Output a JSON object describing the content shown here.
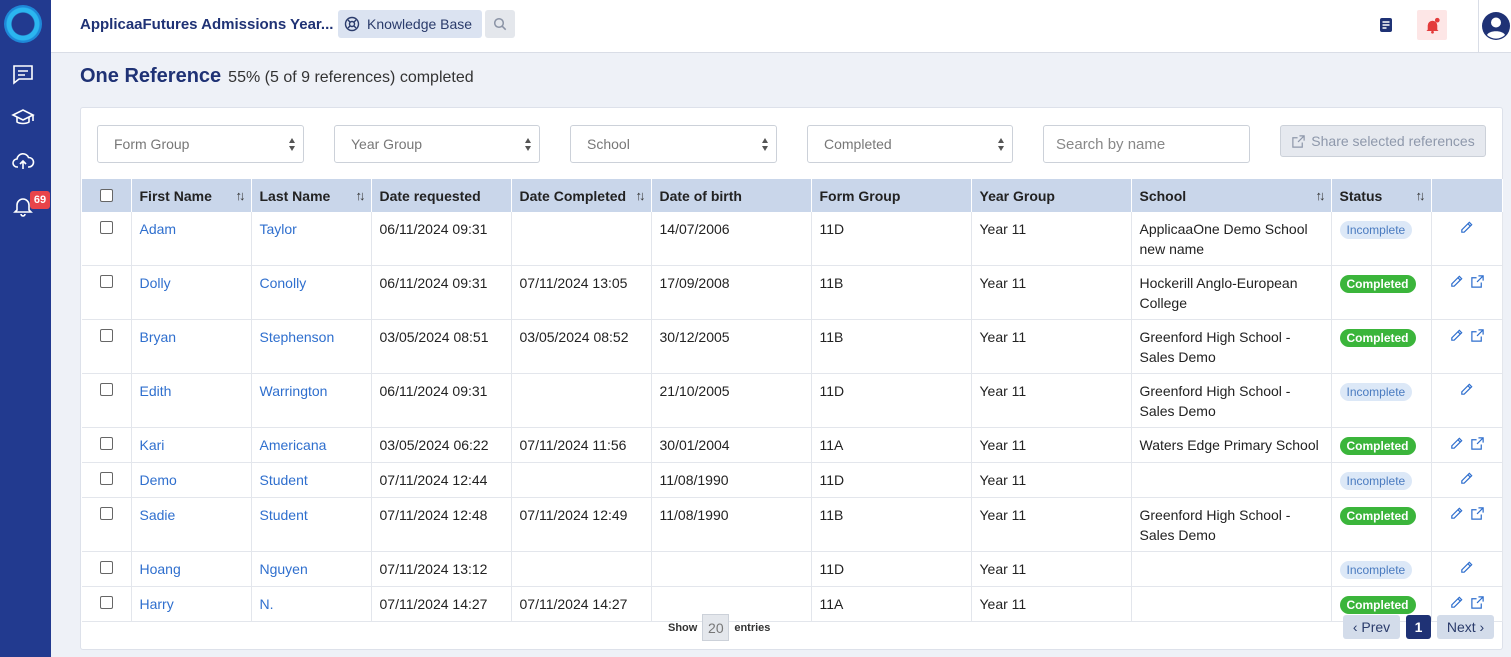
{
  "topbar": {
    "app_title": "ApplicaaFutures Admissions Year...",
    "kb_label": "Knowledge Base"
  },
  "sidebar": {
    "notification_count": "69",
    "icons": [
      "messages-icon",
      "graduation-cap-icon",
      "cloud-upload-icon",
      "bell-icon"
    ]
  },
  "header": {
    "title": "One Reference",
    "progress": "55% (5 of 9 references) completed"
  },
  "filters": {
    "form_group": "Form Group",
    "year_group": "Year Group",
    "school": "School",
    "completed": "Completed",
    "search_placeholder": "Search by name",
    "share_label": "Share selected references"
  },
  "table": {
    "columns": [
      "First Name",
      "Last Name",
      "Date requested",
      "Date Completed",
      "Date of birth",
      "Form Group",
      "Year Group",
      "School",
      "Status"
    ],
    "rows": [
      {
        "first": "Adam",
        "last": "Taylor",
        "requested": "06/11/2024 09:31",
        "completed": "",
        "dob": "14/07/2006",
        "form": "11D",
        "year": "Year 11",
        "school": "ApplicaaOne Demo School new name",
        "status": "Incomplete"
      },
      {
        "first": "Dolly",
        "last": "Conolly",
        "requested": "06/11/2024 09:31",
        "completed": "07/11/2024 13:05",
        "dob": "17/09/2008",
        "form": "11B",
        "year": "Year 11",
        "school": "Hockerill Anglo-European College",
        "status": "Completed"
      },
      {
        "first": "Bryan",
        "last": "Stephenson",
        "requested": "03/05/2024 08:51",
        "completed": "03/05/2024 08:52",
        "dob": "30/12/2005",
        "form": "11B",
        "year": "Year 11",
        "school": "Greenford High School - Sales Demo",
        "status": "Completed"
      },
      {
        "first": "Edith",
        "last": "Warrington",
        "requested": "06/11/2024 09:31",
        "completed": "",
        "dob": "21/10/2005",
        "form": "11D",
        "year": "Year 11",
        "school": "Greenford High School - Sales Demo",
        "status": "Incomplete"
      },
      {
        "first": "Kari",
        "last": "Americana",
        "requested": "03/05/2024 06:22",
        "completed": "07/11/2024 11:56",
        "dob": "30/01/2004",
        "form": "11A",
        "year": "Year 11",
        "school": "Waters Edge Primary School",
        "status": "Completed"
      },
      {
        "first": "Demo",
        "last": "Student",
        "requested": "07/11/2024 12:44",
        "completed": "",
        "dob": "11/08/1990",
        "form": "11D",
        "year": "Year 11",
        "school": "",
        "status": "Incomplete"
      },
      {
        "first": "Sadie",
        "last": "Student",
        "requested": "07/11/2024 12:48",
        "completed": "07/11/2024 12:49",
        "dob": "11/08/1990",
        "form": "11B",
        "year": "Year 11",
        "school": "Greenford High School - Sales Demo",
        "status": "Completed"
      },
      {
        "first": "Hoang",
        "last": "Nguyen",
        "requested": "07/11/2024 13:12",
        "completed": "",
        "dob": "",
        "form": "11D",
        "year": "Year 11",
        "school": "",
        "status": "Incomplete"
      },
      {
        "first": "Harry",
        "last": "N.",
        "requested": "07/11/2024 14:27",
        "completed": "07/11/2024 14:27",
        "dob": "",
        "form": "11A",
        "year": "Year 11",
        "school": "",
        "status": "Completed"
      }
    ]
  },
  "footer": {
    "show_label": "Show",
    "entries_value": "20",
    "entries_label": "entries",
    "prev_label": "‹ Prev",
    "current_page": "1",
    "next_label": "Next ›"
  },
  "colors": {
    "sidebar": "#223a8f",
    "title": "#1f3275",
    "link": "#2f6fce",
    "completed_badge": "#3bb53b",
    "incomplete_badge": "#dce8f7",
    "header_row": "#c9d6ea"
  }
}
